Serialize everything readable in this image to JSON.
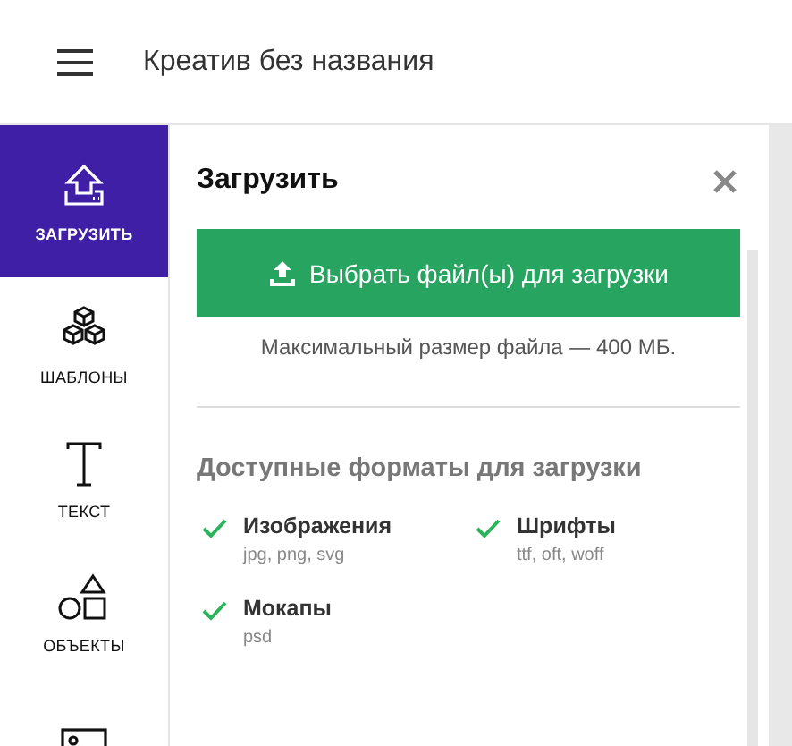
{
  "header": {
    "title": "Креатив без названия"
  },
  "sidebar": {
    "items": [
      {
        "kind": "upload",
        "label": "ЗАГРУЗИТЬ",
        "selected": true
      },
      {
        "kind": "templates",
        "label": "ШАБЛОНЫ",
        "selected": false
      },
      {
        "kind": "text",
        "label": "ТЕКСТ",
        "selected": false
      },
      {
        "kind": "objects",
        "label": "ОБЪЕКТЫ",
        "selected": false
      },
      {
        "kind": "images",
        "selected": false
      }
    ]
  },
  "panel": {
    "title": "Загрузить",
    "upload_button": "Выбрать файл(ы) для загрузки",
    "note": "Максимальный размер файла — 400 МБ.",
    "formats_heading": "Доступные форматы для загрузки",
    "formats": [
      {
        "name": "Изображения",
        "extensions": "jpg, png, svg",
        "checked": true
      },
      {
        "name": "Шрифты",
        "extensions": "ttf, oft, woff",
        "checked": true
      },
      {
        "name": "Мокапы",
        "extensions": "psd",
        "checked": true
      }
    ]
  }
}
